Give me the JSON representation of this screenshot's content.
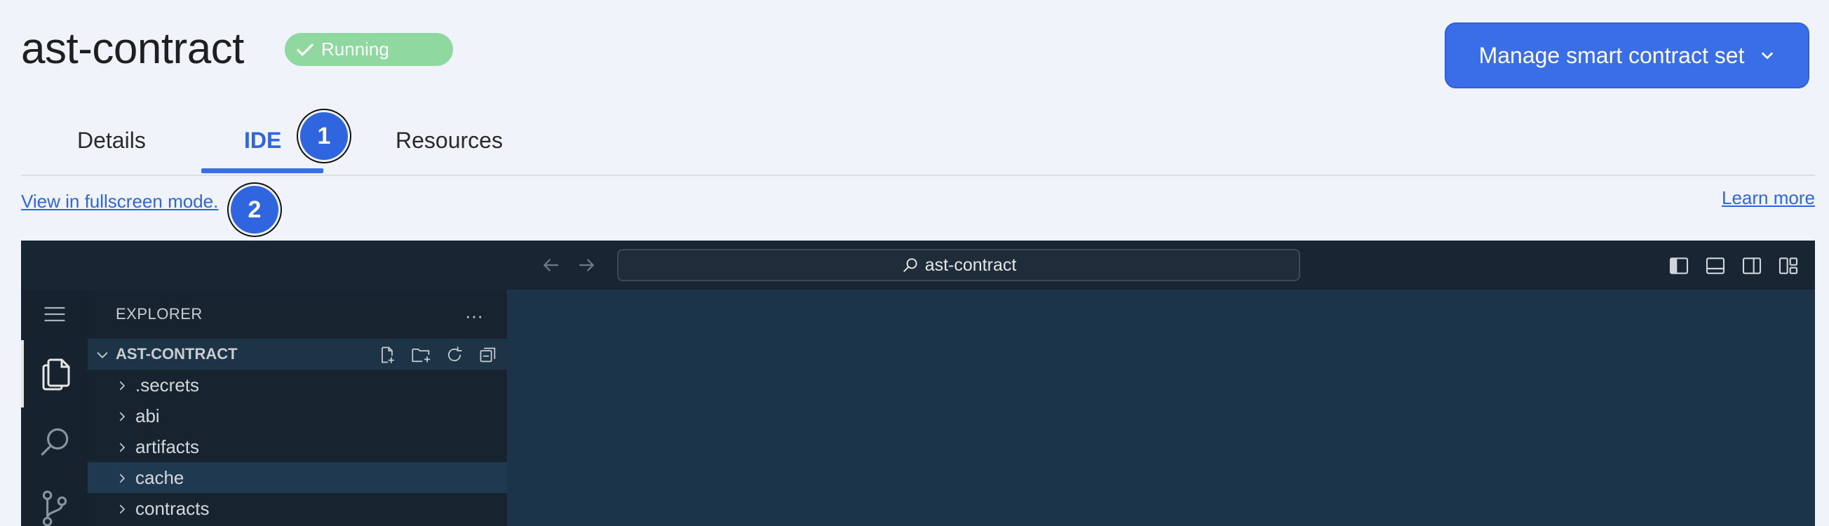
{
  "header": {
    "title": "ast-contract",
    "status": "Running",
    "manage_button": "Manage smart contract set"
  },
  "tabs": [
    {
      "label": "Details",
      "active": false
    },
    {
      "label": "IDE",
      "active": true
    },
    {
      "label": "Resources",
      "active": false
    }
  ],
  "markers": [
    "1",
    "2"
  ],
  "links": {
    "fullscreen": "View in fullscreen mode.",
    "learn_more": "Learn more"
  },
  "ide": {
    "command_center": "ast-contract",
    "explorer_title": "EXPLORER",
    "explorer_more": "···",
    "section_title": "AST-CONTRACT",
    "tree": [
      {
        "name": ".secrets",
        "selected": false
      },
      {
        "name": "abi",
        "selected": false
      },
      {
        "name": "artifacts",
        "selected": false
      },
      {
        "name": "cache",
        "selected": true
      },
      {
        "name": "contracts",
        "selected": false
      }
    ]
  },
  "colors": {
    "accent": "#3a6ee8",
    "status_green": "#8fd9a0",
    "ide_editor_bg": "#1b3449",
    "ide_sidebar_bg": "#172430"
  }
}
